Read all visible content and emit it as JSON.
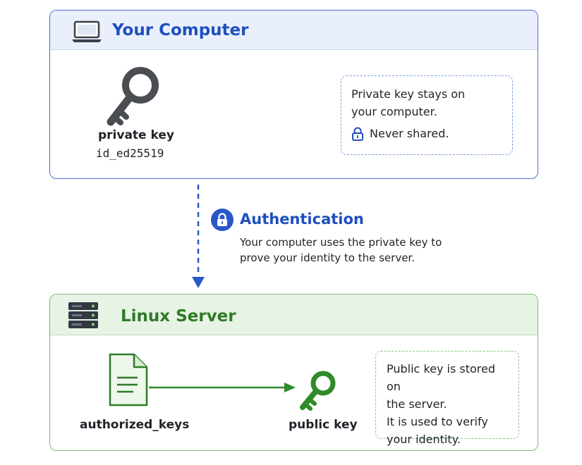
{
  "computer": {
    "title": "Your Computer",
    "icon": "laptop-icon",
    "key_label": "private key",
    "key_file": "id_ed25519",
    "note": {
      "line1": "Private key stays on",
      "line2": "your computer.",
      "line3": "Never shared."
    }
  },
  "authentication": {
    "title": "Authentication",
    "line1": "Your computer uses the private key to",
    "line2": "prove your identity to the server."
  },
  "server": {
    "title": "Linux Server",
    "icon": "server-icon",
    "file_label": "authorized_keys",
    "key_label": "public key",
    "note": {
      "line1": "Public key is stored on",
      "line2": "the server.",
      "line3": "It is used to verify",
      "line4": "your identity."
    }
  },
  "colors": {
    "computer_accent": "#1f4fbf",
    "server_accent": "#2f7a28",
    "key_dark": "#4a4d52",
    "key_green": "#2f8a2a"
  }
}
